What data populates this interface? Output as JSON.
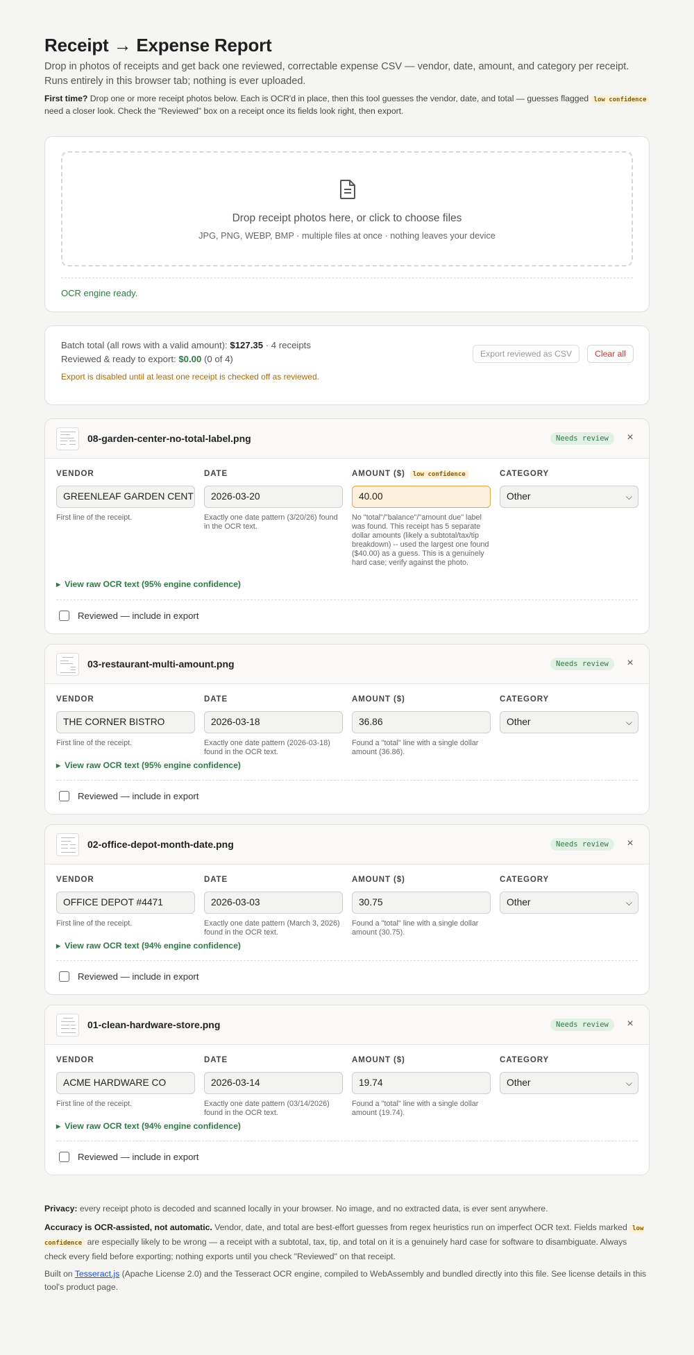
{
  "header": {
    "title": "Receipt → Expense Report",
    "subtitle": "Drop in photos of receipts and get back one reviewed, correctable expense CSV — vendor, date, amount, and category per receipt. Runs entirely in this browser tab; nothing is ever uploaded.",
    "first_time_label": "First time?",
    "first_time_text_a": "Drop one or more receipt photos below. Each is OCR'd in place, then this tool guesses the vendor, date, and total — guesses flagged",
    "first_time_badge": "low confidence",
    "first_time_text_b": "need a closer look. Check the \"Reviewed\" box on a receipt once its fields look right, then export."
  },
  "dropzone": {
    "title": "Drop receipt photos here, or click to choose files",
    "subtitle": "JPG, PNG, WEBP, BMP · multiple files at once · nothing leaves your device",
    "icon": "document-icon",
    "status": "OCR engine ready."
  },
  "batch": {
    "total_label": "Batch total (all rows with a valid amount):",
    "total_value": "$127.35",
    "total_count": "· 4 receipts",
    "reviewed_label": "Reviewed & ready to export:",
    "reviewed_value": "$0.00",
    "reviewed_count": "(0 of 4)",
    "warning": "Export is disabled until at least one receipt is checked off as reviewed.",
    "export_button": "Export reviewed as CSV",
    "clear_button": "Clear all"
  },
  "labels": {
    "vendor": "VENDOR",
    "date": "DATE",
    "amount": "AMOUNT ($)",
    "category": "CATEGORY",
    "needs_review": "Needs review",
    "reviewed_checkbox": "Reviewed — include in export",
    "low_confidence": "low confidence",
    "close": "×"
  },
  "receipts": [
    {
      "filename": "08-garden-center-no-total-label.png",
      "vendor": "GREENLEAF GARDEN CENTER",
      "vendor_hint": "First line of the receipt.",
      "date": "2026-03-20",
      "date_hint": "Exactly one date pattern (3/20/26) found in the OCR text.",
      "amount": "40.00",
      "amount_hint": "No \"total\"/\"balance\"/\"amount due\" label was found. This receipt has 5 separate dollar amounts (likely a subtotal/tax/tip breakdown) -- used the largest one found ($40.00) as a guess. This is a genuinely hard case; verify against the photo.",
      "category": "Other",
      "raw_toggle": "View raw OCR text (95% engine confidence)"
    },
    {
      "filename": "03-restaurant-multi-amount.png",
      "vendor": "THE CORNER BISTRO",
      "vendor_hint": "First line of the receipt.",
      "date": "2026-03-18",
      "date_hint": "Exactly one date pattern (2026-03-18) found in the OCR text.",
      "amount": "36.86",
      "amount_hint": "Found a \"total\" line with a single dollar amount (36.86).",
      "category": "Other",
      "raw_toggle": "View raw OCR text (95% engine confidence)"
    },
    {
      "filename": "02-office-depot-month-date.png",
      "vendor": "OFFICE DEPOT #4471",
      "vendor_hint": "First line of the receipt.",
      "date": "2026-03-03",
      "date_hint": "Exactly one date pattern (March 3, 2026) found in the OCR text.",
      "amount": "30.75",
      "amount_hint": "Found a \"total\" line with a single dollar amount (30.75).",
      "category": "Other",
      "raw_toggle": "View raw OCR text (94% engine confidence)"
    },
    {
      "filename": "01-clean-hardware-store.png",
      "vendor": "ACME HARDWARE CO",
      "vendor_hint": "First line of the receipt.",
      "date": "2026-03-14",
      "date_hint": "Exactly one date pattern (03/14/2026) found in the OCR text.",
      "amount": "19.74",
      "amount_hint": "Found a \"total\" line with a single dollar amount (19.74).",
      "category": "Other",
      "raw_toggle": "View raw OCR text (94% engine confidence)"
    }
  ],
  "footer": {
    "privacy_label": "Privacy:",
    "privacy_text": "every receipt photo is decoded and scanned locally in your browser. No image, and no extracted data, is ever sent anywhere.",
    "accuracy_label": "Accuracy is OCR-assisted, not automatic.",
    "accuracy_text_a": "Vendor, date, and total are best-effort guesses from regex heuristics run on imperfect OCR text. Fields marked",
    "accuracy_badge": "low confidence",
    "accuracy_text_b": "are especially likely to be wrong — a receipt with a subtotal, tax, tip, and total on it is a genuinely hard case for software to disambiguate. Always check every field before exporting; nothing exports until you check \"Reviewed\" on that receipt.",
    "built_a": "Built on",
    "built_link": "Tesseract.js",
    "built_b": "(Apache License 2.0) and the Tesseract OCR engine, compiled to WebAssembly and bundled directly into this file. See license details in this tool's product page."
  },
  "colors": {
    "accent_green": "#2f7a45",
    "warning_orange": "#b06a00",
    "danger_red": "#c0392b",
    "low_conf_bg": "#fdf0dc"
  }
}
